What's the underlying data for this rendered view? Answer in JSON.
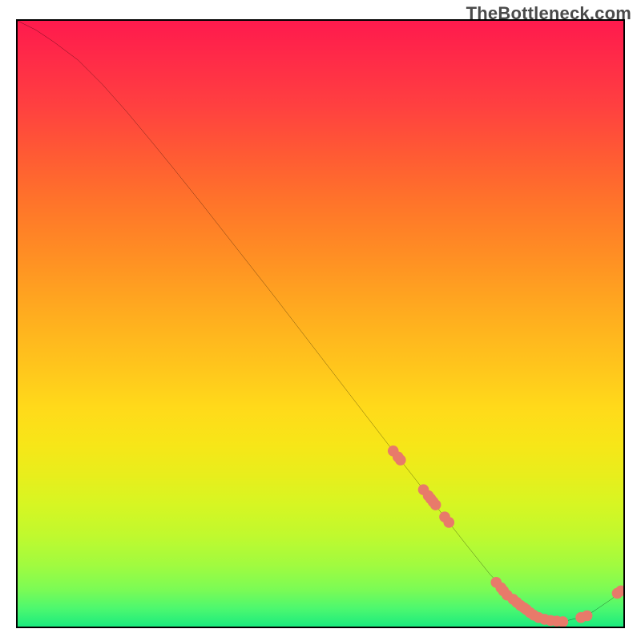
{
  "watermark": "TheBottleneck.com",
  "chart_data": {
    "type": "line",
    "title": "",
    "xlabel": "",
    "ylabel": "",
    "xlim": [
      0,
      100
    ],
    "ylim": [
      0,
      100
    ],
    "grid": false,
    "note": "x/y are normalized percentages across the plot area (0–100). y=100 is top, y=0 is bottom. The background encodes value via a vertical red→yellow→green gradient; the black path is the curve. Salmon-colored points are plotted along the latter portion of the curve.",
    "curve": {
      "color": "#000000",
      "x": [
        0,
        3,
        6,
        10,
        14,
        18,
        22,
        26,
        30,
        34,
        38,
        42,
        46,
        50,
        54,
        58,
        62,
        66,
        70,
        74,
        78,
        82,
        86,
        90,
        94,
        98,
        100
      ],
      "y": [
        100,
        98.5,
        96.5,
        93.5,
        89.5,
        85.0,
        80.2,
        75.3,
        70.3,
        65.2,
        60.1,
        55.0,
        49.8,
        44.6,
        39.4,
        34.2,
        29.0,
        23.9,
        18.7,
        13.6,
        8.6,
        4.5,
        1.9,
        0.8,
        1.8,
        4.5,
        6.1
      ]
    },
    "points": {
      "color": "#e87a6a",
      "radius": 0.9,
      "x": [
        62.0,
        62.8,
        63.2,
        67.0,
        67.8,
        68.2,
        68.6,
        69.0,
        70.5,
        71.2,
        79.0,
        79.8,
        80.2,
        80.8,
        81.8,
        82.4,
        83.0,
        83.6,
        84.0,
        84.6,
        85.2,
        86.0,
        87.0,
        88.0,
        89.0,
        90.0,
        93.0,
        94.0,
        99.0,
        99.6
      ],
      "y": [
        29.0,
        28.0,
        27.5,
        22.6,
        21.6,
        21.1,
        20.6,
        20.1,
        18.1,
        17.2,
        7.3,
        6.4,
        5.9,
        5.2,
        4.5,
        4.0,
        3.5,
        3.1,
        2.8,
        2.3,
        1.9,
        1.5,
        1.2,
        1.0,
        0.9,
        0.8,
        1.5,
        1.8,
        5.5,
        5.9
      ]
    }
  }
}
